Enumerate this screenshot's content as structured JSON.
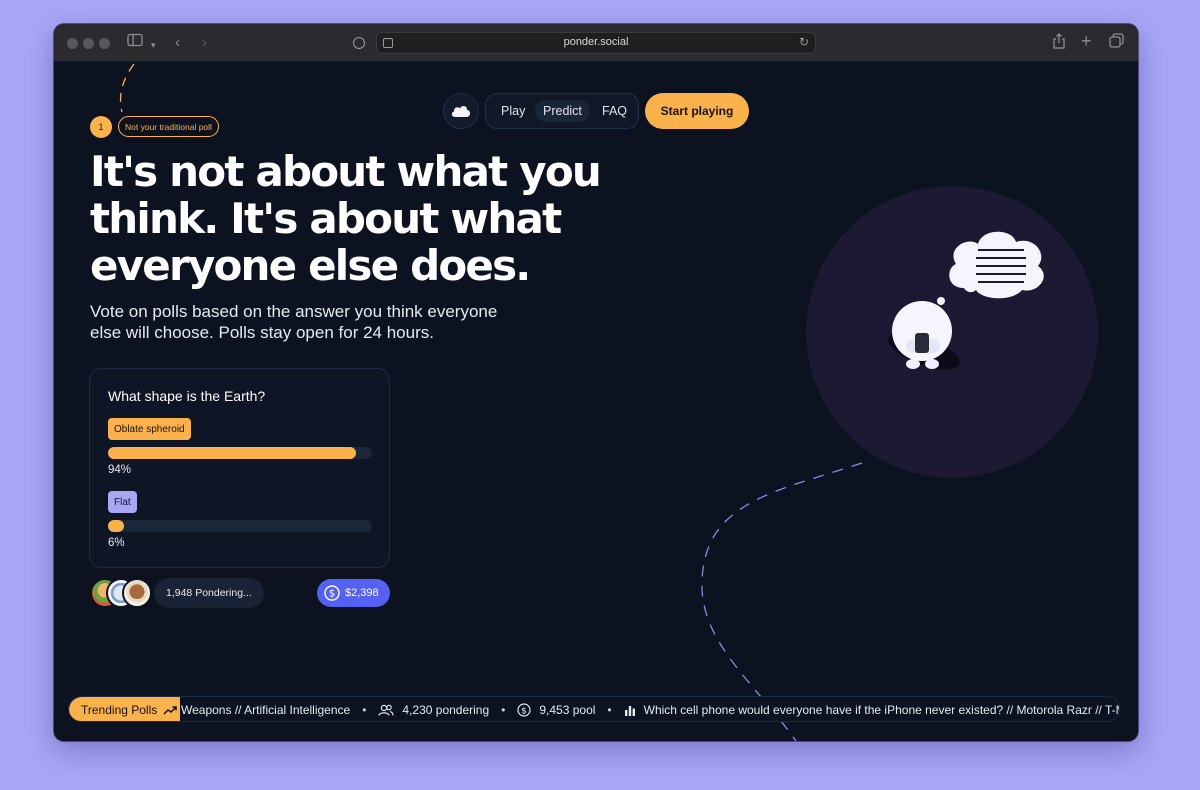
{
  "browser": {
    "url": "ponder.social"
  },
  "nav": {
    "links": [
      "Play",
      "Predict",
      "FAQ"
    ],
    "active_link": "Predict",
    "cta": "Start playing",
    "logo_icon": "cloud-icon"
  },
  "hero": {
    "step_number": "1",
    "step_label": "Not your traditional poll",
    "headline": "It's not about what you think. It's about what everyone else does.",
    "subtitle": "Vote on polls based on the answer you think everyone else will choose. Polls stay open for 24 hours."
  },
  "poll": {
    "question": "What shape is the Earth?",
    "options": [
      {
        "label": "Oblate spheroid",
        "percent": 94,
        "percent_text": "94%",
        "color": "#fbb24d"
      },
      {
        "label": "Flat",
        "percent": 6,
        "percent_text": "6%",
        "color": "#a9a7f5"
      }
    ],
    "pondering": "1,948 Pondering...",
    "pool": "$2,398"
  },
  "ticker": {
    "label": "Trending Polls",
    "item1_text": "Weapons // Artificial Intelligence",
    "item1_pondering": "4,230 pondering",
    "item1_pool": "9,453 pool",
    "item2_text": "Which cell phone would everyone have if the iPhone never existed? // Motorola Razr // T-Mobile Sidek"
  },
  "colors": {
    "accent": "#fbb24d",
    "purple": "#a9a7f5",
    "pool_blue": "#5561f2",
    "background": "#0c1220"
  }
}
